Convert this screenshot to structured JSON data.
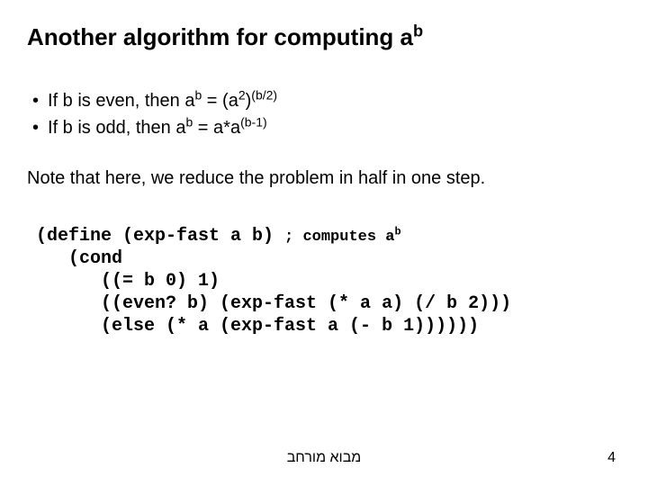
{
  "title": {
    "prefix": "Another algorithm for  computing a",
    "sup": "b"
  },
  "bullets": [
    {
      "lead": "If b is even, then  a",
      "sup1": "b",
      "mid": " =  (a",
      "sup2": "2",
      "mid2": ")",
      "sup3": "(b/2)"
    },
    {
      "lead": "If b is odd, then  a",
      "sup1": "b",
      "mid": " = a*a",
      "sup2": "(b-1)"
    }
  ],
  "note": "Note that here, we reduce the problem in half in one step.",
  "code": {
    "l1a": "(define (exp-fast a b) ",
    "l1b": "; computes a",
    "l1b_sup": "b",
    "l2": "   (cond",
    "l3": "      ((= b 0) 1)",
    "l4": "      ((even? b) (exp-fast (* a a) (/ b 2)))",
    "l5": "      (else (* a (exp-fast a (- b 1))))))"
  },
  "footer": {
    "center": "מבוא מורחב",
    "page": "4"
  }
}
